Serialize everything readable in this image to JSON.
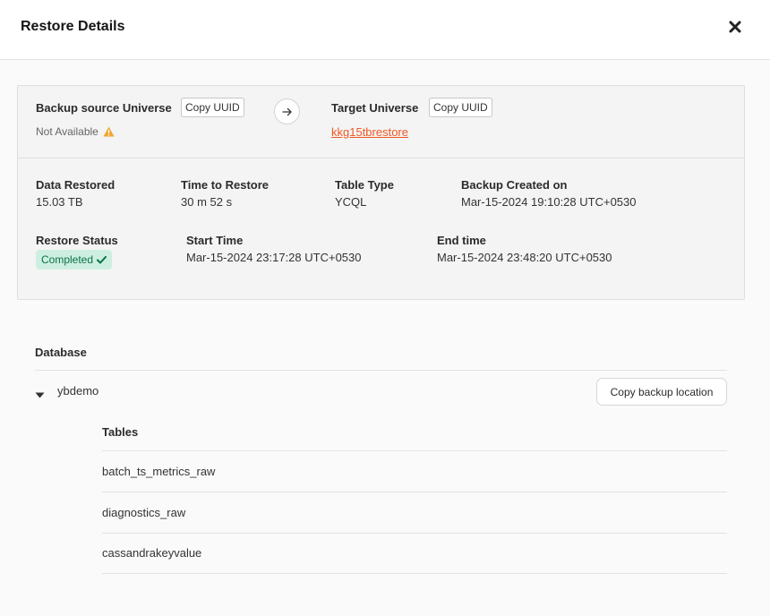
{
  "header": {
    "title": "Restore Details"
  },
  "source": {
    "label": "Backup source Universe",
    "copy_label": "Copy UUID",
    "value": "Not Available"
  },
  "target": {
    "label": "Target Universe",
    "copy_label": "Copy UUID",
    "value": "kkg15tbrestore"
  },
  "stats": {
    "data_restored": {
      "label": "Data Restored",
      "value": "15.03 TB"
    },
    "time_to_restore": {
      "label": "Time to Restore",
      "value": "30 m 52 s"
    },
    "table_type": {
      "label": "Table Type",
      "value": "YCQL"
    },
    "backup_created": {
      "label": "Backup Created on",
      "value": "Mar-15-2024 19:10:28 UTC+0530"
    },
    "restore_status": {
      "label": "Restore Status",
      "value": "Completed"
    },
    "start_time": {
      "label": "Start Time",
      "value": "Mar-15-2024 23:17:28 UTC+0530"
    },
    "end_time": {
      "label": "End time",
      "value": "Mar-15-2024 23:48:20 UTC+0530"
    }
  },
  "database": {
    "label": "Database",
    "name": "ybdemo",
    "copy_location_label": "Copy backup location",
    "tables_label": "Tables",
    "tables": [
      "batch_ts_metrics_raw",
      "diagnostics_raw",
      "cassandrakeyvalue"
    ]
  },
  "colors": {
    "link": "#ef5824",
    "warning": "#f2a52f",
    "success_bg": "#cdefe1",
    "success_text": "#097245"
  },
  "icons": [
    "close-icon",
    "warning-icon",
    "arrow-right-icon",
    "check-icon",
    "caret-down-icon"
  ]
}
